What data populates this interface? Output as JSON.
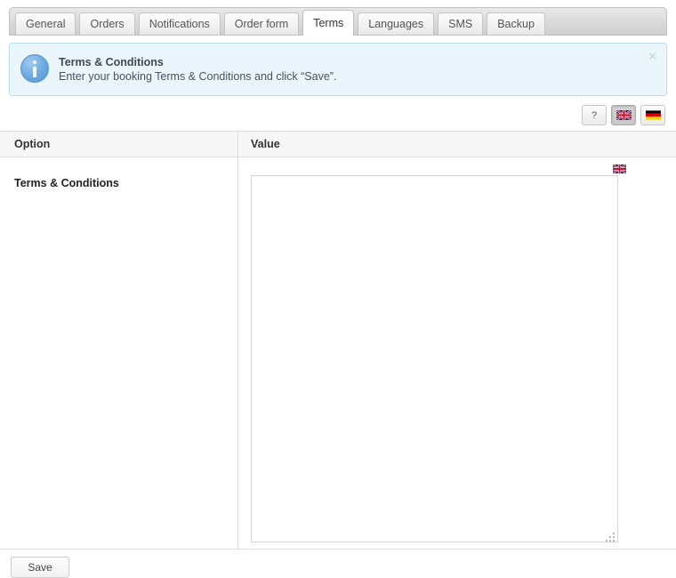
{
  "tabs": [
    {
      "label": "General",
      "active": false
    },
    {
      "label": "Orders",
      "active": false
    },
    {
      "label": "Notifications",
      "active": false
    },
    {
      "label": "Order form",
      "active": false
    },
    {
      "label": "Terms",
      "active": true
    },
    {
      "label": "Languages",
      "active": false
    },
    {
      "label": "SMS",
      "active": false
    },
    {
      "label": "Backup",
      "active": false
    }
  ],
  "notice": {
    "icon": "info-icon",
    "title": "Terms & Conditions",
    "description": "Enter your booking Terms & Conditions and click “Save”.",
    "close_label": "×"
  },
  "toolbar": {
    "help_label": "?",
    "help_icon": "question-mark-icon",
    "lang_en_icon": "uk-flag-icon",
    "lang_en_pressed": true,
    "lang_de_icon": "german-flag-icon",
    "lang_de_pressed": false
  },
  "table": {
    "headers": {
      "option": "Option",
      "value": "Value"
    },
    "rows": [
      {
        "option": "Terms & Conditions",
        "value": "",
        "placeholder": "",
        "flag_icon": "uk-flag-icon"
      }
    ]
  },
  "footer": {
    "save_label": "Save"
  },
  "colors": {
    "notice_bg": "#eaf5fc",
    "notice_border": "#bcdcef",
    "notice_icon": "#5596d4",
    "tabbar_bg": "#dcdcdc",
    "active_tab_bg": "#ffffff",
    "grid_header_bg": "#f7f7f7",
    "grid_border": "#dedede"
  }
}
